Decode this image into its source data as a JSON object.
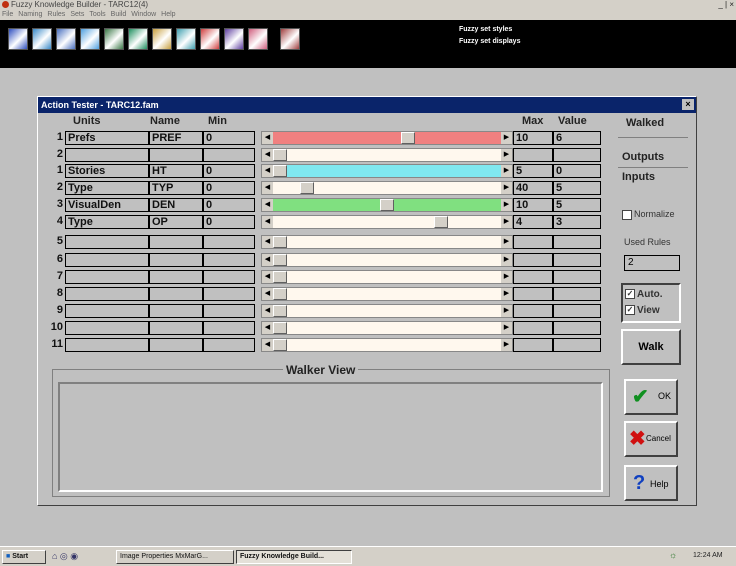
{
  "app": {
    "title": "Fuzzy Knowledge Builder - TARC12(4)",
    "window_controls": "_ | ×",
    "menu": [
      "File",
      "Naming",
      "Rules",
      "Sets",
      "Tools",
      "Build",
      "Window",
      "Help"
    ]
  },
  "toolbar": {
    "buttons": [
      {
        "name": "tb-icon-1",
        "color": "#3050c0"
      },
      {
        "name": "tb-icon-2",
        "color": "#3a8ac8"
      },
      {
        "name": "tb-icon-3",
        "color": "#4a70c0"
      },
      {
        "name": "tb-icon-4",
        "color": "#50a0e0"
      },
      {
        "name": "tb-icon-5",
        "color": "#3c7848"
      },
      {
        "name": "tb-icon-6",
        "color": "#209060"
      },
      {
        "name": "tb-icon-7",
        "color": "#c8a040"
      },
      {
        "name": "tb-icon-8",
        "color": "#40a0b0"
      },
      {
        "name": "tb-icon-9",
        "color": "#d04040"
      },
      {
        "name": "tb-icon-10",
        "color": "#6040a0"
      },
      {
        "name": "tb-icon-11",
        "color": "#d06080"
      },
      {
        "name": "tb-icon-12",
        "color": "#a04040"
      }
    ],
    "text1": "Fuzzy set styles",
    "text2": "Fuzzy set displays"
  },
  "dialog": {
    "title": "Action Tester - TARC12.fam",
    "close": "×",
    "headers": {
      "units": "Units",
      "name": "Name",
      "min": "Min",
      "max": "Max",
      "value": "Value"
    },
    "rows": [
      {
        "num": "1",
        "unit": "Prefs",
        "name": "PREF",
        "min": "0",
        "max": "10",
        "value": "6",
        "bar": "#f08080",
        "level": 0.6
      },
      {
        "num": "2",
        "unit": "",
        "name": "",
        "min": "",
        "max": "",
        "value": "",
        "bar": "",
        "level": 0
      },
      {
        "num": "1",
        "unit": "Stories",
        "name": "HT",
        "min": "0",
        "max": "5",
        "value": "0",
        "bar": "#80e8f0",
        "level": 0
      },
      {
        "num": "2",
        "unit": "Type",
        "name": "TYP",
        "min": "0",
        "max": "40",
        "value": "5",
        "bar": "",
        "level": 0.125
      },
      {
        "num": "3",
        "unit": "VisualDen",
        "name": "DEN",
        "min": "0",
        "max": "10",
        "value": "5",
        "bar": "#80e080",
        "level": 0.5
      },
      {
        "num": "4",
        "unit": "Type",
        "name": "OP",
        "min": "0",
        "max": "4",
        "value": "3",
        "bar": "",
        "level": 0.75
      },
      {
        "num": "5",
        "unit": "",
        "name": "",
        "min": "",
        "max": "",
        "value": "",
        "bar": "",
        "level": 0
      },
      {
        "num": "6",
        "unit": "",
        "name": "",
        "min": "",
        "max": "",
        "value": "",
        "bar": "",
        "level": 0
      },
      {
        "num": "7",
        "unit": "",
        "name": "",
        "min": "",
        "max": "",
        "value": "",
        "bar": "",
        "level": 0
      },
      {
        "num": "8",
        "unit": "",
        "name": "",
        "min": "",
        "max": "",
        "value": "",
        "bar": "",
        "level": 0
      },
      {
        "num": "9",
        "unit": "",
        "name": "",
        "min": "",
        "max": "",
        "value": "",
        "bar": "",
        "level": 0
      },
      {
        "num": "10",
        "unit": "",
        "name": "",
        "min": "",
        "max": "",
        "value": "",
        "bar": "",
        "level": 0
      },
      {
        "num": "11",
        "unit": "",
        "name": "",
        "min": "",
        "max": "",
        "value": "",
        "bar": "",
        "level": 0
      }
    ],
    "side": {
      "walked": "Walked",
      "outputs": "Outputs",
      "inputs": "Inputs",
      "normalize": "Normalize",
      "used_rules_label": "Used Rules",
      "used_rules_value": "2",
      "auto": "Auto.",
      "view": "View",
      "walk": "Walk",
      "ok": "OK",
      "cancel": "Cancel",
      "help": "Help"
    },
    "walker_title": "Walker View"
  },
  "taskbar": {
    "start": "Start",
    "item1": "Image Properties MxMarG...",
    "item2": "Fuzzy Knowledge Build...",
    "clock": "12:24 AM"
  }
}
